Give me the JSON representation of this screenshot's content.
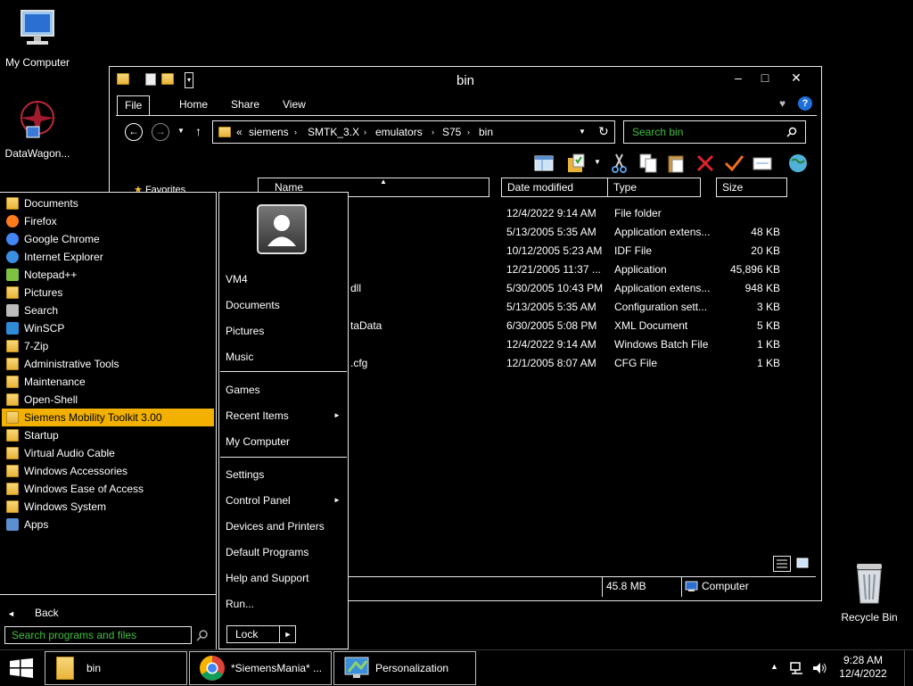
{
  "desktop": {
    "icons": [
      {
        "label": "My Computer"
      },
      {
        "label": "DataWagon..."
      },
      {
        "label": "Recycle Bin"
      }
    ]
  },
  "window": {
    "title": "bin",
    "controls": {
      "minimize": "–",
      "maximize": "□",
      "close": "✕"
    },
    "ribbon_tabs": [
      "File",
      "Home",
      "Share",
      "View"
    ],
    "address": {
      "prefix": "«",
      "crumbs": [
        "siemens",
        "SMTK_3.X",
        "emulators",
        "S75",
        "bin"
      ]
    },
    "search_placeholder": "Search bin",
    "nav_favorites": "Favorites",
    "columns": {
      "name": "Name",
      "date": "Date modified",
      "type": "Type",
      "size": "Size"
    },
    "files": [
      {
        "name": "",
        "date": "12/4/2022 9:14 AM",
        "type": "File folder",
        "size": ""
      },
      {
        "name": "",
        "date": "5/13/2005 5:35 AM",
        "type": "Application extens...",
        "size": "48 KB"
      },
      {
        "name": "",
        "date": "10/12/2005 5:23 AM",
        "type": "IDF File",
        "size": "20 KB"
      },
      {
        "name": "",
        "date": "12/21/2005 11:37 ...",
        "type": "Application",
        "size": "45,896 KB"
      },
      {
        "name": "dll",
        "date": "5/30/2005 10:43 PM",
        "type": "Application extens...",
        "size": "948 KB"
      },
      {
        "name": "",
        "date": "5/13/2005 5:35 AM",
        "type": "Configuration sett...",
        "size": "3 KB"
      },
      {
        "name": "taData",
        "date": "6/30/2005 5:08 PM",
        "type": "XML Document",
        "size": "5 KB"
      },
      {
        "name": "",
        "date": "12/4/2022 9:14 AM",
        "type": "Windows Batch File",
        "size": "1 KB"
      },
      {
        "name": ".cfg",
        "date": "12/1/2005 8:07 AM",
        "type": "CFG File",
        "size": "1 KB"
      }
    ],
    "status": {
      "size": "45.8 MB",
      "location": "Computer"
    }
  },
  "start_menu": {
    "programs": [
      {
        "label": "Documents",
        "icon": "folder-icon"
      },
      {
        "label": "Firefox",
        "icon": "firefox-icon"
      },
      {
        "label": "Google Chrome",
        "icon": "chrome-icon"
      },
      {
        "label": "Internet Explorer",
        "icon": "ie-icon"
      },
      {
        "label": "Notepad++",
        "icon": "notepad-icon"
      },
      {
        "label": "Pictures",
        "icon": "folder-icon"
      },
      {
        "label": "Search",
        "icon": "search-icon"
      },
      {
        "label": "WinSCP",
        "icon": "winscp-icon"
      },
      {
        "label": "7-Zip",
        "icon": "folder-icon"
      },
      {
        "label": "Administrative Tools",
        "icon": "folder-icon"
      },
      {
        "label": "Maintenance",
        "icon": "folder-icon"
      },
      {
        "label": "Open-Shell",
        "icon": "folder-icon"
      },
      {
        "label": "Siemens Mobility Toolkit 3.00",
        "icon": "folder-icon"
      },
      {
        "label": "Startup",
        "icon": "folder-icon"
      },
      {
        "label": "Virtual Audio Cable",
        "icon": "folder-icon"
      },
      {
        "label": "Windows Accessories",
        "icon": "folder-icon"
      },
      {
        "label": "Windows Ease of Access",
        "icon": "folder-icon"
      },
      {
        "label": "Windows System",
        "icon": "folder-icon"
      },
      {
        "label": "Apps",
        "icon": "apps-icon"
      }
    ],
    "highlighted_index": 12,
    "back_label": "Back",
    "search_placeholder": "Search programs and files",
    "right_items": [
      {
        "label": "VM4",
        "arrow": false
      },
      {
        "label": "Documents",
        "arrow": false
      },
      {
        "label": "Pictures",
        "arrow": false
      },
      {
        "label": "Music",
        "arrow": false
      },
      {
        "label": "Games",
        "arrow": false
      },
      {
        "label": "Recent Items",
        "arrow": true
      },
      {
        "label": "My Computer",
        "arrow": false
      },
      {
        "label": "Settings",
        "arrow": false
      },
      {
        "label": "Control Panel",
        "arrow": true
      },
      {
        "label": "Devices and Printers",
        "arrow": false
      },
      {
        "label": "Default Programs",
        "arrow": false
      },
      {
        "label": "Help and Support",
        "arrow": false
      },
      {
        "label": "Run...",
        "arrow": false
      }
    ],
    "lock_label": "Lock"
  },
  "taskbar": {
    "buttons": [
      {
        "label": "bin"
      },
      {
        "label": "*SiemensMania* ..."
      },
      {
        "label": "Personalization"
      }
    ],
    "clock": {
      "time": "9:28 AM",
      "date": "12/4/2022"
    }
  },
  "colors": {
    "highlight": "#f2b100",
    "search_text": "#3fbf3f",
    "accent_blue": "#1e6fd9"
  }
}
